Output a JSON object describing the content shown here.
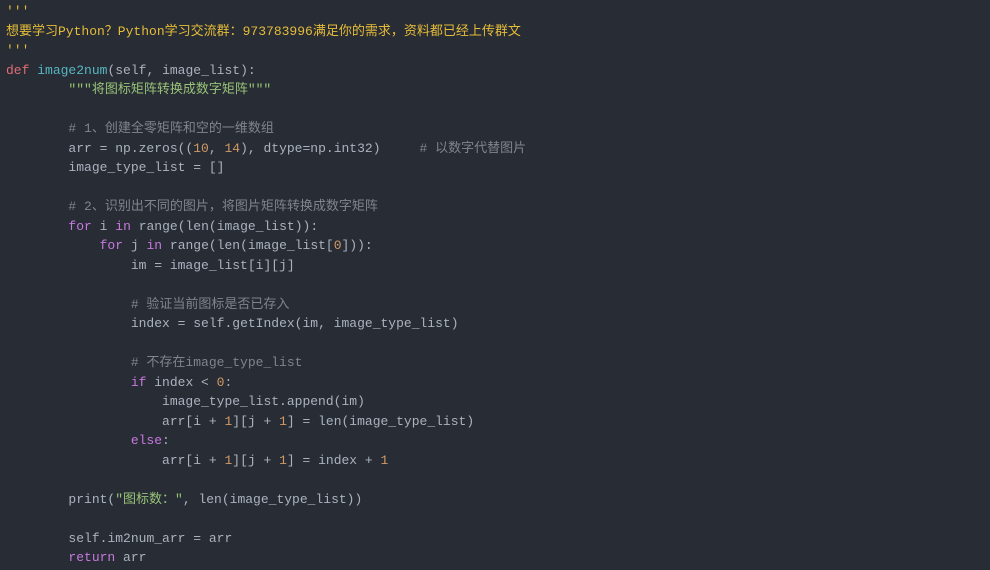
{
  "header": {
    "ellipsis_top": "'''",
    "banner": "想要学习Python？Python学习交流群：973783996满足你的需求，资料都已经上传群文",
    "ellipsis_bottom": "'''"
  },
  "code": {
    "def_kw": "def",
    "fn_name": "image2num",
    "sig_open": "(",
    "self": "self",
    "sep1": ", ",
    "param": "image_list",
    "sig_close": "):",
    "docstring": "\"\"\"将图标矩阵转换成数字矩阵\"\"\"",
    "c1": "# 1、创建全零矩阵和空的一维数组",
    "l_arr": "arr = np.zeros((",
    "n10": "10",
    "comma_sp": ", ",
    "n14": "14",
    "l_arr2": "), dtype=np.int32)     ",
    "c1b": "# 以数字代替图片",
    "l_itl": "image_type_list = []",
    "c2": "# 2、识别出不同的图片，将图片矩阵转换成数字矩阵",
    "for_kw": "for",
    "i_var": "i",
    "in_kw": "in",
    "range_call1": "range(len(image_list)):",
    "j_var": "j",
    "range_call2": "range(len(image_list[",
    "n0": "0",
    "range_call2_close": "])):",
    "l_im": "im = image_list[i][j]",
    "c3": "# 验证当前图标是否已存入",
    "l_index": "index = ",
    "self2": "self",
    "getIndex": ".getIndex(im, image_type_list)",
    "c4": "# 不存在image_type_list",
    "if_kw": "if",
    "cond": " index < ",
    "colon": ":",
    "l_append": "image_type_list.append(im)",
    "l_arr_assign_a": "arr[i + ",
    "n1a": "1",
    "l_arr_assign_b": "][j + ",
    "n1b": "1",
    "l_arr_assign_c": "] = len(image_type_list)",
    "else_kw": "else",
    "l_arr_assign2_c": "] = index + ",
    "n1c": "1",
    "print_open": "print(",
    "print_str": "\"图标数：\"",
    "print_rest": ", len(image_type_list))",
    "l_selfim": "self",
    "l_selfim2": ".im2num_arr = arr",
    "return_kw": "return",
    "return_var": " arr"
  }
}
